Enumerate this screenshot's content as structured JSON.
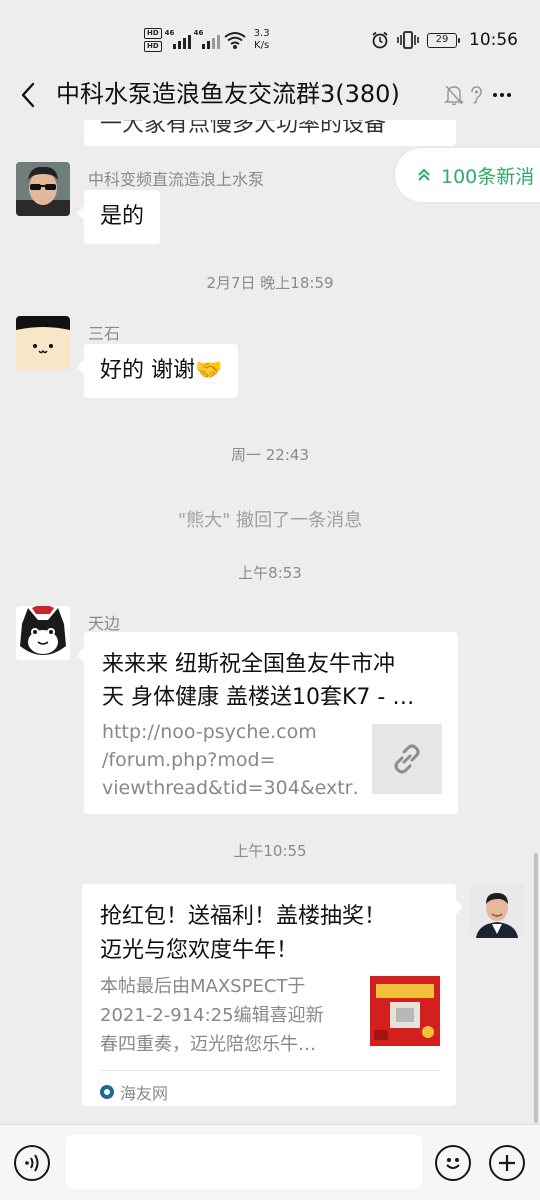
{
  "status_bar": {
    "hd_label": "HD",
    "network_label": "46",
    "speed_value": "3.3",
    "speed_unit": "K/s",
    "battery": "29",
    "time": "10:56"
  },
  "nav": {
    "title": "中科水泵造浪鱼友交流群3(380)"
  },
  "new_messages_button": {
    "label": "100条新消"
  },
  "prior_bubble_fragment": "一大家有点慢多大功率的设备",
  "messages": [
    {
      "type": "text",
      "sender": "中科变频直流造浪上水泵",
      "text": "是的"
    },
    {
      "type": "time",
      "text": "2月7日 晚上18:59"
    },
    {
      "type": "text",
      "sender": "三石",
      "text": "好的 谢谢🤝"
    },
    {
      "type": "time",
      "text": "周一 22:43"
    },
    {
      "type": "system",
      "text": "\"熊大\" 撤回了一条消息"
    },
    {
      "type": "time",
      "text": "上午8:53"
    },
    {
      "type": "link",
      "sender": "天边",
      "title_line1": "来来来 纽斯祝全国鱼友牛市冲",
      "title_line2": "天 身体健康 盖楼送10套K7 - …",
      "desc_line1": "http://noo-psyche.com",
      "desc_line2": "/forum.php?mod=",
      "desc_line3": "viewthread&tid=304&extr…"
    },
    {
      "type": "time",
      "text": "上午10:55"
    },
    {
      "type": "article",
      "sender": "",
      "title_line1": "抢红包！送福利！盖楼抽奖！",
      "title_line2": "迈光与您欢度牛年！",
      "desc_line1": "本帖最后由MAXSPECT于",
      "desc_line2": "2021-2-914:25编辑喜迎新",
      "desc_line3": "春四重奏，迈光陪您乐牛…",
      "source": "海友网"
    }
  ],
  "input": {
    "placeholder": ""
  },
  "colors": {
    "accent": "#2aae67",
    "background": "#ededed",
    "bubble": "#ffffff"
  }
}
